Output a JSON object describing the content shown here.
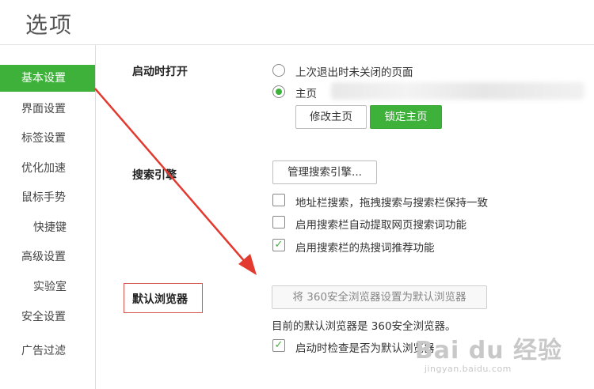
{
  "header": {
    "title": "选项"
  },
  "sidebar": {
    "items": [
      {
        "label": "基本设置",
        "active": true
      },
      {
        "label": "界面设置",
        "active": false
      },
      {
        "label": "标签设置",
        "active": false
      },
      {
        "label": "优化加速",
        "active": false
      },
      {
        "label": "鼠标手势",
        "active": false
      },
      {
        "label": "快捷键",
        "active": false
      },
      {
        "label": "高级设置",
        "active": false
      },
      {
        "label": "实验室",
        "active": false
      },
      {
        "label": "安全设置",
        "active": false
      },
      {
        "label": "广告过滤",
        "active": false
      }
    ]
  },
  "startup": {
    "label": "启动时打开",
    "options": [
      {
        "label": "上次退出时未关闭的页面",
        "selected": false
      },
      {
        "label": "主页",
        "selected": true
      }
    ],
    "edit_home_button": "修改主页",
    "lock_home_button": "锁定主页"
  },
  "search": {
    "label": "搜索引擎",
    "manage_button": "管理搜索引擎...",
    "options": [
      {
        "label": "地址栏搜索，拖拽搜索与搜索栏保持一致",
        "checked": false
      },
      {
        "label": "启用搜索栏自动提取网页搜索词功能",
        "checked": false
      },
      {
        "label": "启用搜索栏的热搜词推荐功能",
        "checked": true
      }
    ]
  },
  "default_browser": {
    "label": "默认浏览器",
    "set_default_button": "将 360安全浏览器设置为默认浏览器",
    "status": "目前的默认浏览器是 360安全浏览器。",
    "check_on_startup": {
      "label": "启动时检查是否为默认浏览器",
      "checked": true
    }
  },
  "watermark": {
    "main": "Bai du 经验",
    "sub": "jingyan.baidu.com"
  },
  "colors": {
    "accent": "#3eb13a",
    "highlight_border": "#d9534f",
    "arrow": "#e23a2f"
  },
  "icons": {
    "checkmark": "✓"
  }
}
